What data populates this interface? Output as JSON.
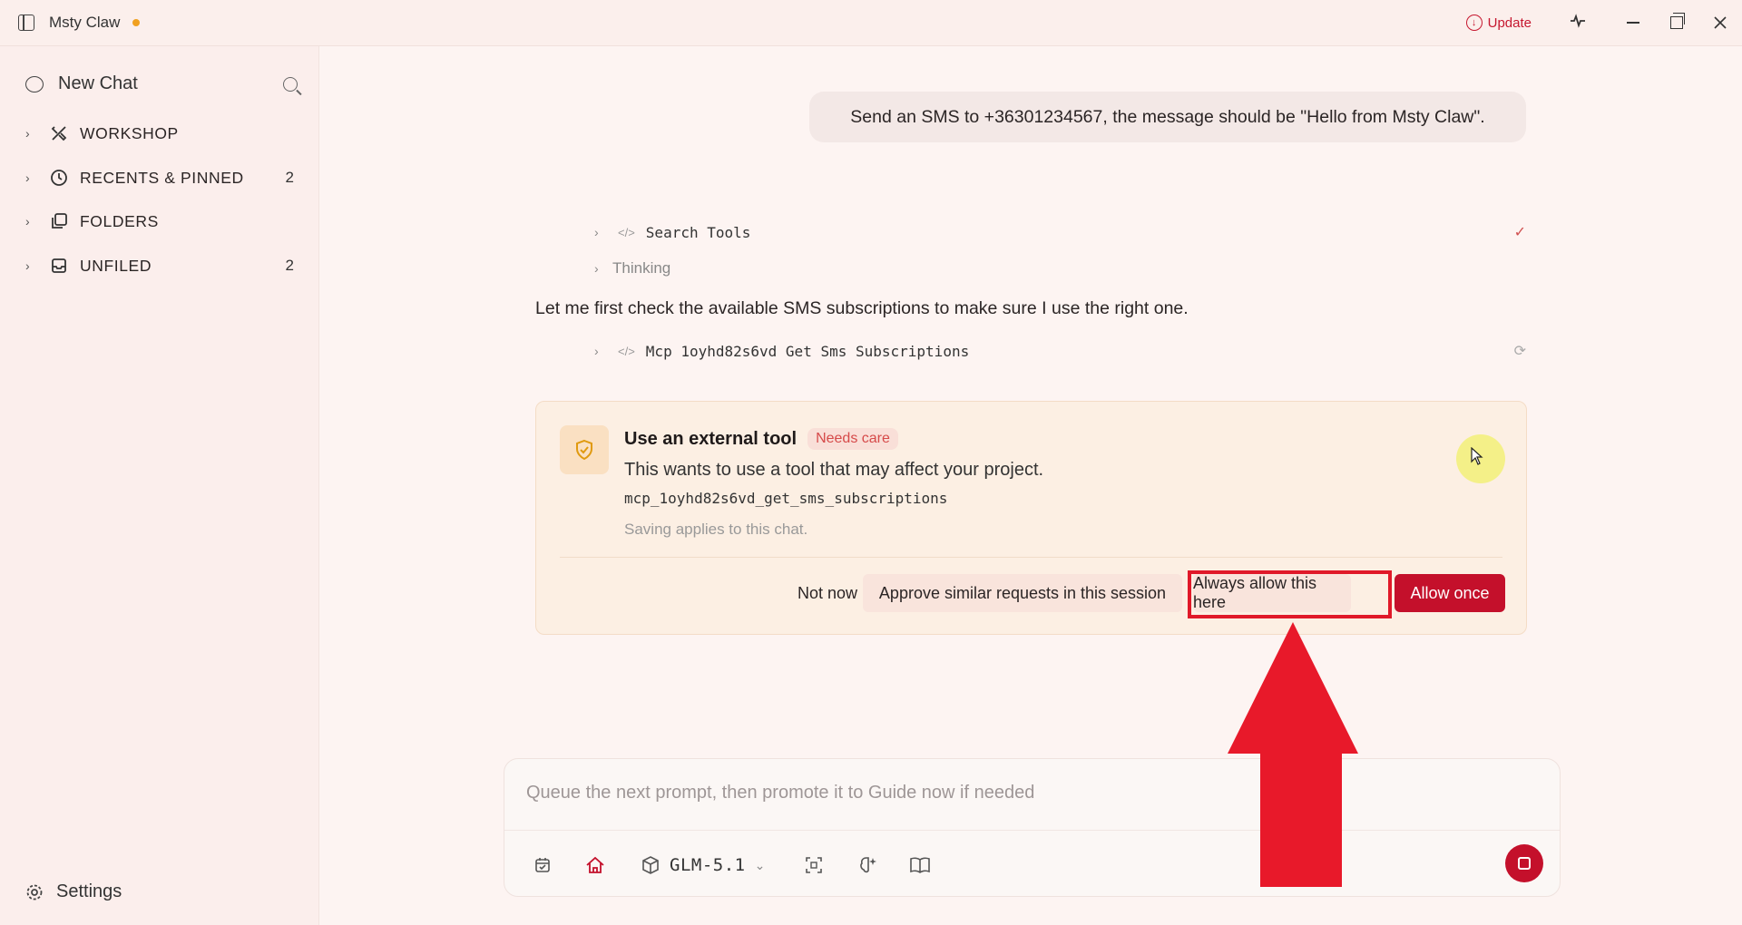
{
  "app": {
    "title": "Msty Claw",
    "update_label": "Update"
  },
  "sidebar": {
    "new_chat": "New Chat",
    "items": [
      {
        "label": "WORKSHOP",
        "count": ""
      },
      {
        "label": "RECENTS & PINNED",
        "count": "2"
      },
      {
        "label": "FOLDERS",
        "count": ""
      },
      {
        "label": "UNFILED",
        "count": "2"
      }
    ],
    "settings": "Settings"
  },
  "conversation": {
    "user_message": "Send an SMS to +36301234567, the message should be \"Hello from Msty Claw\".",
    "tool_call_1": "Search Tools",
    "thinking_label": "Thinking",
    "assistant_text": "Let me first check the available SMS subscriptions to make sure I use the right one.",
    "tool_call_2": "Mcp 1oyhd82s6vd Get Sms Subscriptions"
  },
  "permission": {
    "title": "Use an external tool",
    "badge": "Needs care",
    "description": "This wants to use a tool that may affect your project.",
    "tool_id": "mcp_1oyhd82s6vd_get_sms_subscriptions",
    "note": "Saving applies to this chat.",
    "buttons": {
      "not_now": "Not now",
      "approve_similar": "Approve similar requests in this session",
      "always_allow": "Always allow this here",
      "allow_once": "Allow once"
    }
  },
  "composer": {
    "placeholder": "Queue the next prompt, then promote it to Guide now if needed",
    "model": "GLM-5.1"
  },
  "colors": {
    "accent": "#c4102b",
    "annotation": "#e01929",
    "card_bg": "#fcefe3",
    "sidebar_bg": "#fbeeec"
  }
}
